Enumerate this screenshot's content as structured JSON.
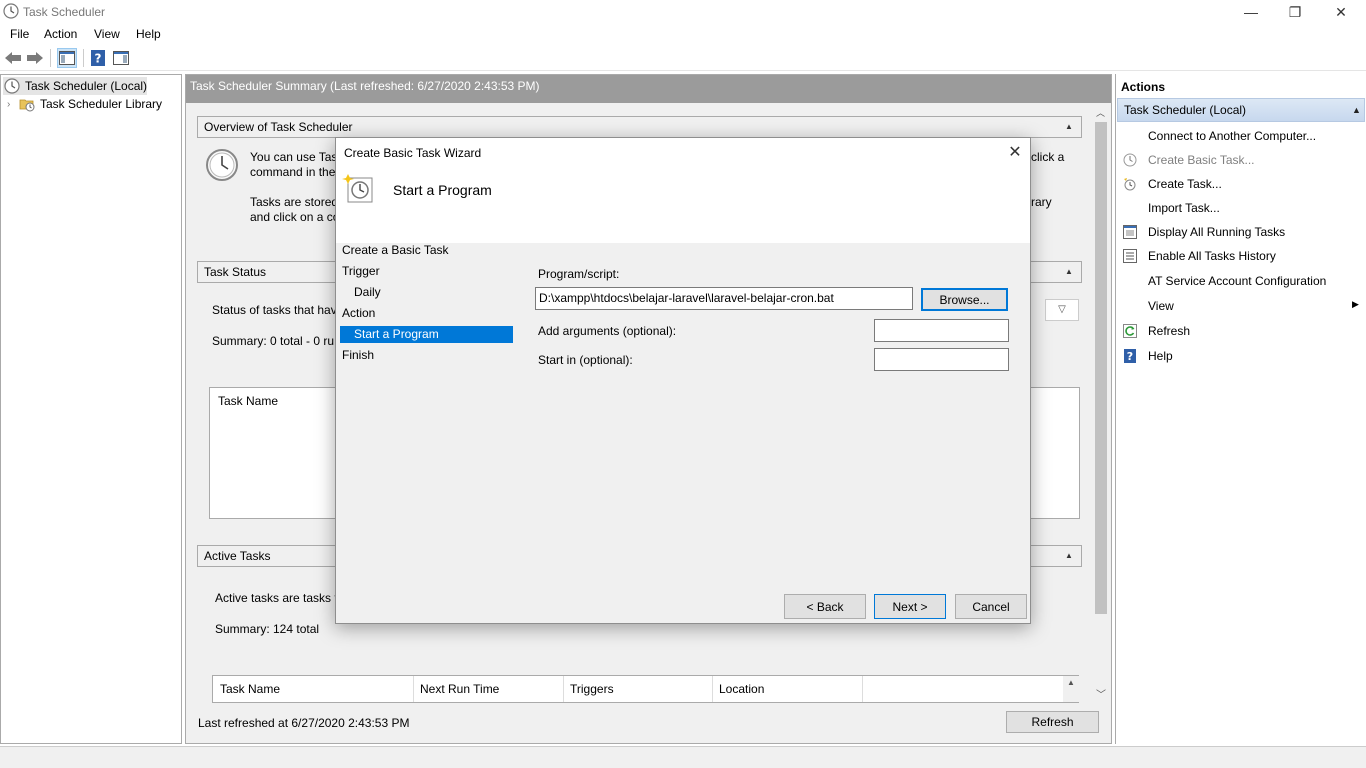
{
  "window": {
    "title": "Task Scheduler",
    "minimize_glyph": "—",
    "restore_glyph": "❐",
    "close_glyph": "✕"
  },
  "menu": [
    "File",
    "Action",
    "View",
    "Help"
  ],
  "tree": {
    "root": "Task Scheduler (Local)",
    "child": "Task Scheduler Library"
  },
  "center": {
    "header": "Task Scheduler Summary (Last refreshed: 6/27/2020 2:43:53 PM)",
    "overview": {
      "title": "Overview of Task Scheduler",
      "line1_start": "You can use Task",
      "line1_end": "click a",
      "line2_start": "command in the",
      "line3_start": "Tasks are stored",
      "line3_end": "rary",
      "line4_start": "and click on a co"
    },
    "status": {
      "title": "Task Status",
      "text": "Status of tasks that have",
      "summary": "Summary: 0 total - 0 ru",
      "column": "Task Name"
    },
    "active": {
      "title": "Active Tasks",
      "text": "Active tasks are tasks th",
      "summary": "Summary: 124 total",
      "columns": [
        "Task Name",
        "Next Run Time",
        "Triggers",
        "Location"
      ]
    },
    "last_refreshed": "Last refreshed at 6/27/2020 2:43:53 PM",
    "refresh_button": "Refresh"
  },
  "actions": {
    "title": "Actions",
    "group": "Task Scheduler (Local)",
    "items": [
      {
        "label": "Connect to Another Computer...",
        "icon": "none",
        "disabled": false
      },
      {
        "label": "Create Basic Task...",
        "icon": "clock-icon",
        "disabled": true
      },
      {
        "label": "Create Task...",
        "icon": "new-task-icon",
        "disabled": false
      },
      {
        "label": "Import Task...",
        "icon": "none",
        "disabled": false
      },
      {
        "label": "Display All Running Tasks",
        "icon": "running-tasks-icon",
        "disabled": false
      },
      {
        "label": "Enable All Tasks History",
        "icon": "history-icon",
        "disabled": false
      },
      {
        "label": "AT Service Account Configuration",
        "icon": "none",
        "disabled": false
      },
      {
        "label": "View",
        "icon": "none",
        "disabled": false
      },
      {
        "label": "Refresh",
        "icon": "refresh-icon",
        "disabled": false
      },
      {
        "label": "Help",
        "icon": "help-icon",
        "disabled": false
      }
    ]
  },
  "wizard": {
    "title": "Create Basic Task Wizard",
    "heading": "Start a Program",
    "steps": [
      {
        "label": "Create a Basic Task",
        "sub": false,
        "selected": false
      },
      {
        "label": "Trigger",
        "sub": false,
        "selected": false
      },
      {
        "label": "Daily",
        "sub": true,
        "selected": false
      },
      {
        "label": "Action",
        "sub": false,
        "selected": false
      },
      {
        "label": "Start a Program",
        "sub": true,
        "selected": true
      },
      {
        "label": "Finish",
        "sub": false,
        "selected": false
      }
    ],
    "program_label": "Program/script:",
    "program_value": "D:\\xampp\\htdocs\\belajar-laravel\\laravel-belajar-cron.bat",
    "browse_button": "Browse...",
    "args_label": "Add arguments (optional):",
    "args_value": "",
    "startin_label": "Start in (optional):",
    "startin_value": "",
    "back_button": "< Back",
    "next_button": "Next >",
    "cancel_button": "Cancel"
  }
}
